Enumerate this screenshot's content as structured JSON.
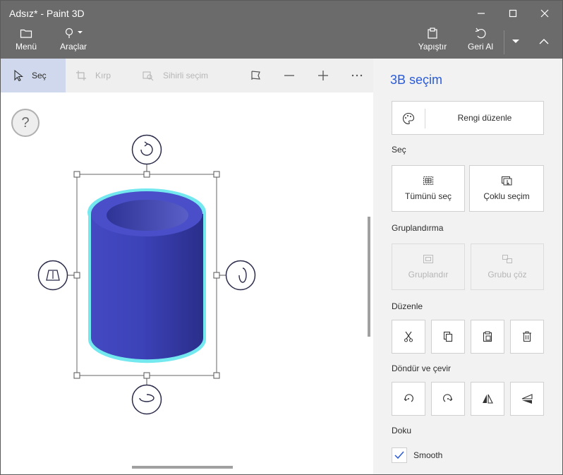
{
  "window": {
    "title": "Adsız* - Paint 3D"
  },
  "ribbon": {
    "menu_label": "Menü",
    "tools_label": "Araçlar",
    "paste_label": "Yapıştır",
    "undo_label": "Geri Al"
  },
  "toolbar": {
    "select_label": "Seç",
    "crop_label": "Kırp",
    "magic_select_label": "Sihirli seçim"
  },
  "canvas": {
    "help_label": "?"
  },
  "panel": {
    "title": "3B seçim",
    "edit_color_label": "Rengi düzenle",
    "select_section": "Seç",
    "select_all_label": "Tümünü seç",
    "multi_select_label": "Çoklu seçim",
    "group_section": "Gruplandırma",
    "group_label": "Gruplandır",
    "ungroup_label": "Grubu çöz",
    "edit_section": "Düzenle",
    "rotate_section": "Döndür ve çevir",
    "texture_section": "Doku",
    "smooth_label": "Smooth",
    "smooth_checked": true
  },
  "colors": {
    "accent": "#2a5bd7",
    "cylinder": "#3c42b8",
    "selection_glow": "#74e8ef",
    "topbar": "#6b6b6b"
  }
}
